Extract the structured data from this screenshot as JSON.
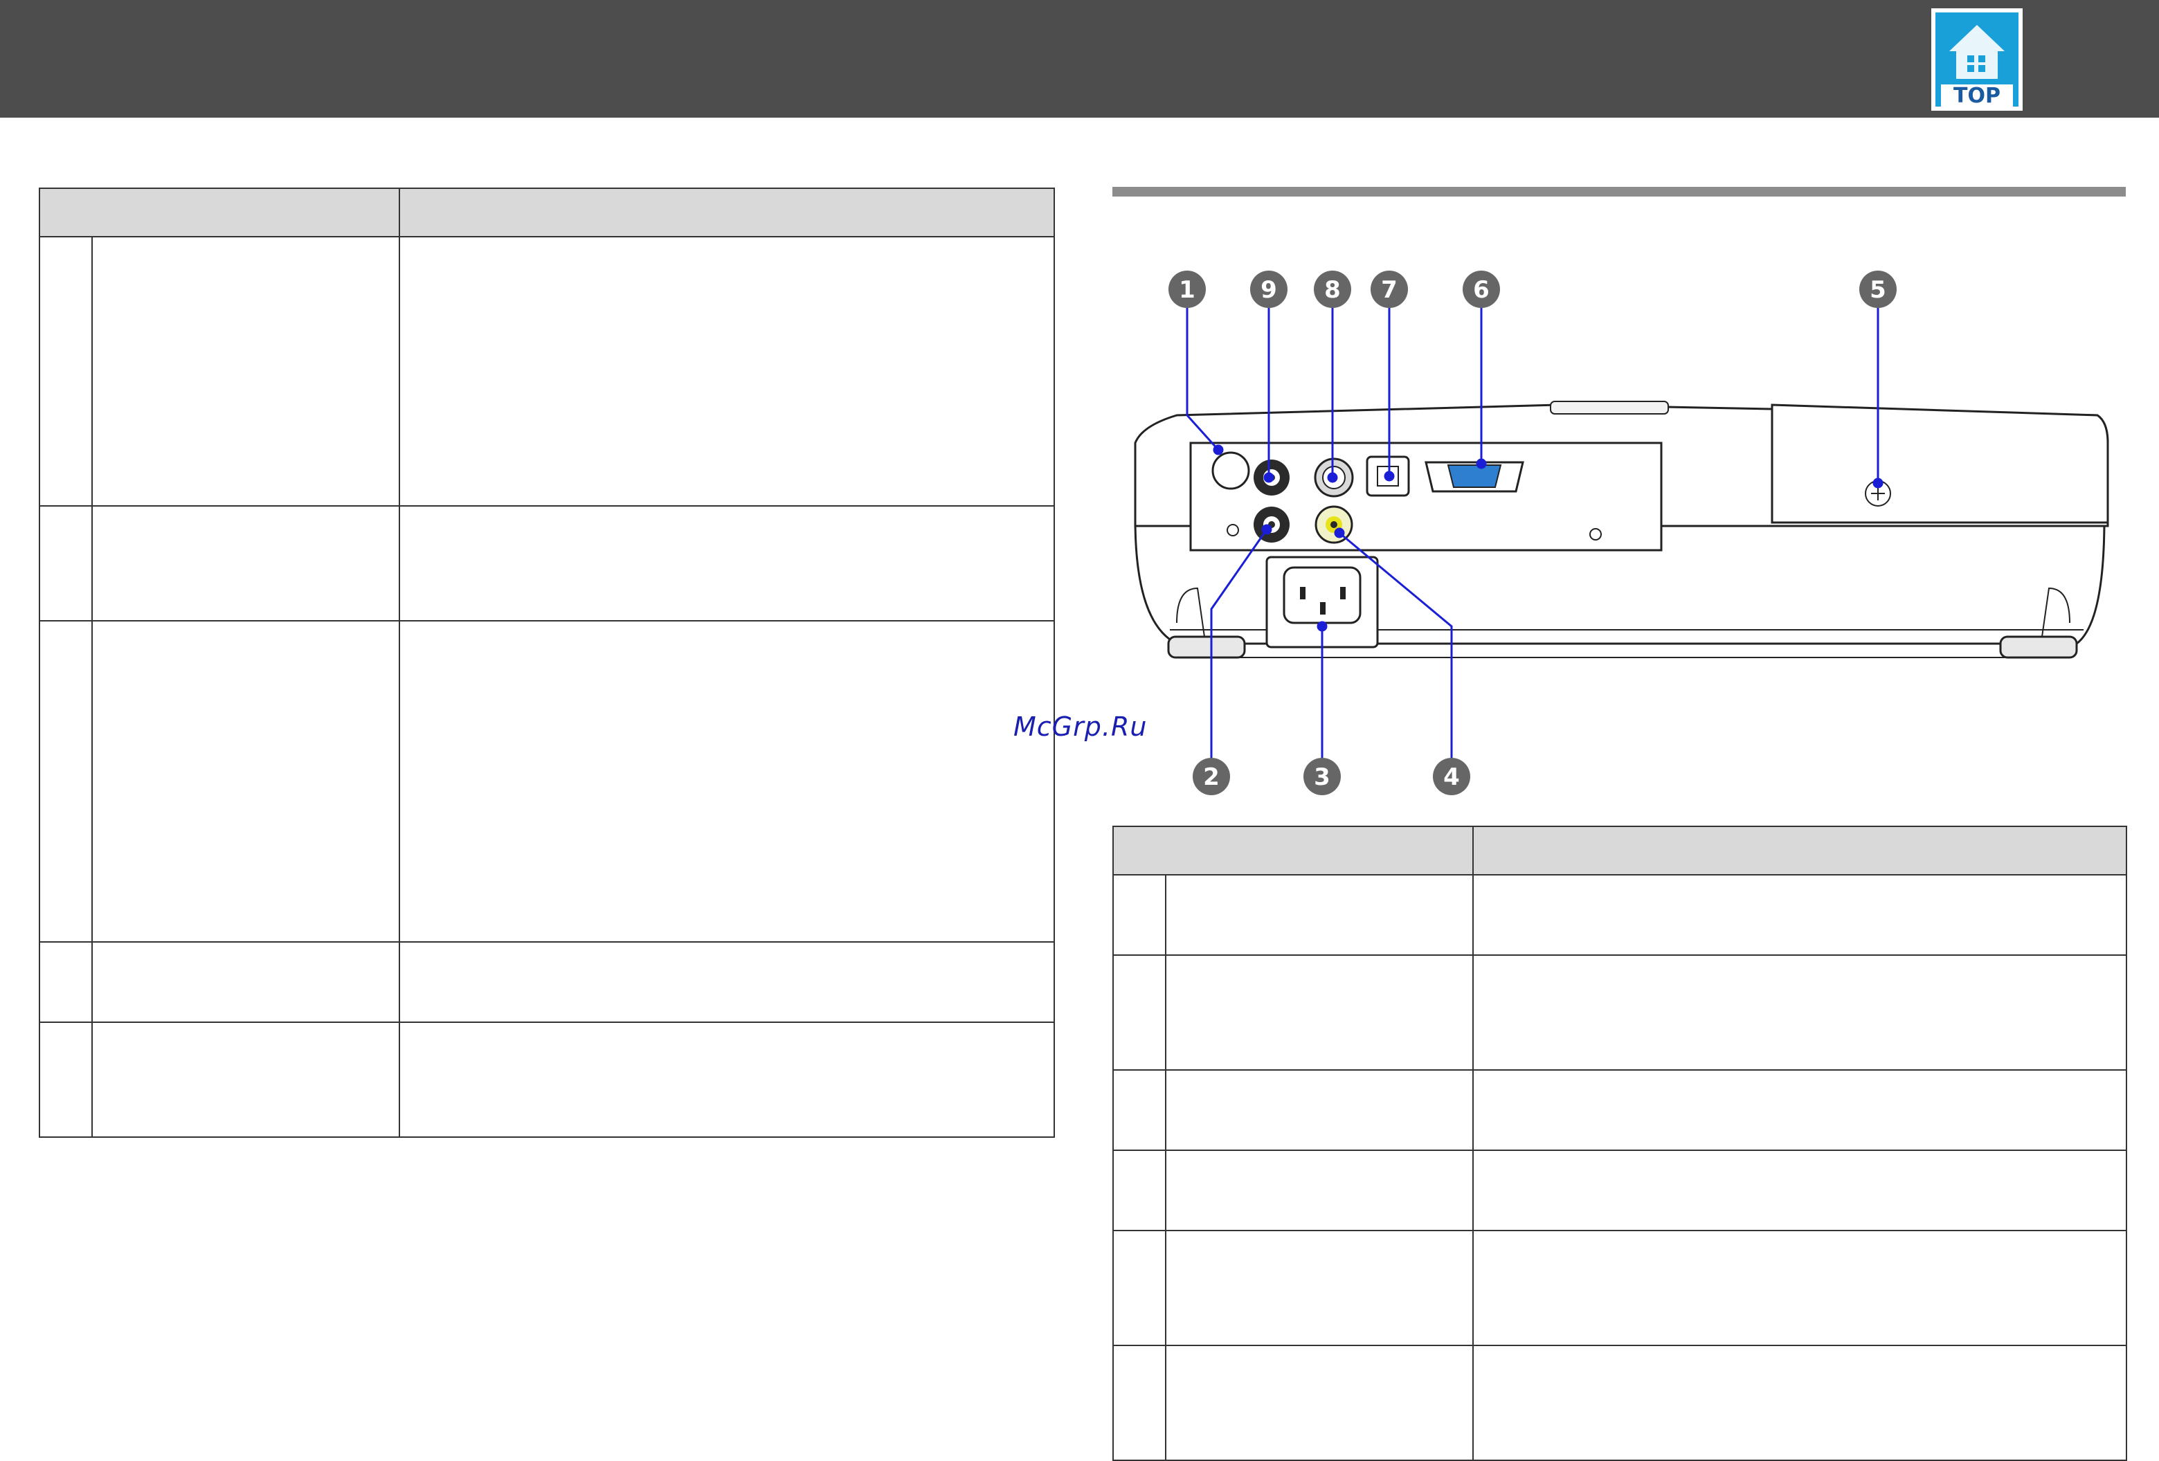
{
  "header": {
    "top_button": {
      "label": "TOP"
    }
  },
  "watermark": "McGrp.Ru",
  "diagram": {
    "callouts": [
      "1",
      "9",
      "8",
      "7",
      "6",
      "5",
      "2",
      "3",
      "4"
    ],
    "accent_color": "#1a1fd6"
  },
  "left_table": {
    "headers": [
      "",
      ""
    ],
    "rows": [
      {
        "num": "",
        "name": "",
        "desc": ""
      },
      {
        "num": "",
        "name": "",
        "desc": ""
      },
      {
        "num": "",
        "name": "",
        "desc": ""
      },
      {
        "num": "",
        "name": "",
        "desc": ""
      },
      {
        "num": "",
        "name": "",
        "desc": ""
      }
    ]
  },
  "right_table": {
    "headers": [
      "",
      ""
    ],
    "rows": [
      {
        "num": "",
        "name": "",
        "desc": ""
      },
      {
        "num": "",
        "name": "",
        "desc": ""
      },
      {
        "num": "",
        "name": "",
        "desc": ""
      },
      {
        "num": "",
        "name": "",
        "desc": ""
      },
      {
        "num": "",
        "name": "",
        "desc": ""
      },
      {
        "num": "",
        "name": "",
        "desc": ""
      }
    ]
  }
}
